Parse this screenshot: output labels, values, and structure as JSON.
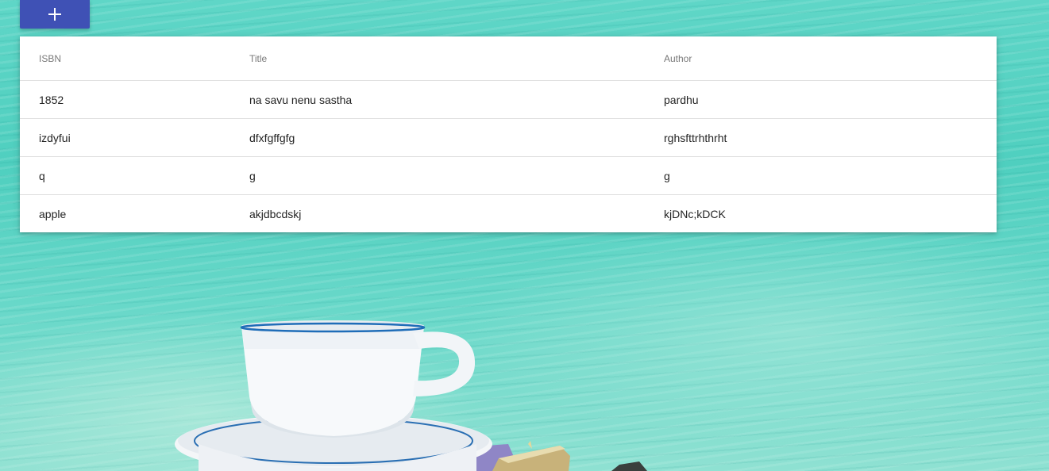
{
  "toolbar": {
    "add_icon": "plus-icon"
  },
  "table": {
    "columns": [
      "ISBN",
      "Title",
      "Author"
    ],
    "rows": [
      [
        "1852",
        "na savu nenu sastha",
        "pardhu"
      ],
      [
        "izdyfui",
        "dfxfgffgfg",
        "rghsfttrhthrht"
      ],
      [
        "q",
        "g",
        "g"
      ],
      [
        "apple",
        "akjdbcdskj",
        "kjDNc;kDCK"
      ]
    ]
  },
  "colors": {
    "accent": "#3f51b5",
    "background": "#5fd6c7"
  }
}
